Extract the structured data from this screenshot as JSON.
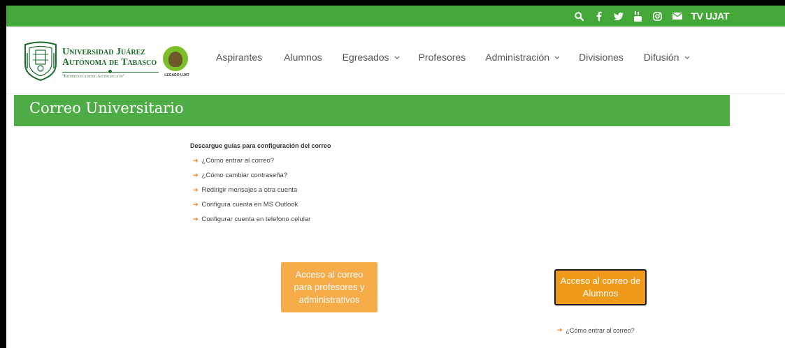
{
  "topbar": {
    "icons": [
      "search-icon",
      "facebook-icon",
      "twitter-icon",
      "youtube-icon",
      "instagram-icon",
      "mail-icon"
    ],
    "tv_label": "TV UJAT"
  },
  "header": {
    "university_line1": "Universidad Juárez",
    "university_line2": "Autónoma de Tabasco",
    "motto": "\"Estudio en la duda. Acción en la fe\"",
    "legado_label": "LEGADO UJAT"
  },
  "nav": {
    "items": [
      {
        "label": "Aspirantes",
        "dropdown": false
      },
      {
        "label": "Alumnos",
        "dropdown": false
      },
      {
        "label": "Egresados",
        "dropdown": true
      },
      {
        "label": "Profesores",
        "dropdown": false
      },
      {
        "label": "Administración",
        "dropdown": true
      },
      {
        "label": "Divisiones",
        "dropdown": false
      },
      {
        "label": "Difusión",
        "dropdown": true
      }
    ]
  },
  "banner": {
    "title": "Correo Universitario"
  },
  "guides": {
    "heading": "Descargue guías para configuración del correo",
    "links": [
      "¿Cómo entrar al correo?",
      "¿Cómo cambiar contraseña?",
      "Redirigir mensajes a otra cuenta",
      "Configura cuenta en MS Outlook",
      "Configurar cuenta en telefono celular"
    ]
  },
  "buttons": {
    "profesores": "Acceso al correo para profesores y administrativos",
    "alumnos": "Acceso al correo de Alumnos"
  },
  "alumnos_link": "¿Cómo entrar al correo?",
  "colors": {
    "topbar": "#43a838",
    "banner": "#4eac46",
    "brand_green": "#1c6b2a",
    "accent_orange": "#f27a1a",
    "button_light": "#f7ac4a",
    "button_dark": "#f09a1c"
  }
}
